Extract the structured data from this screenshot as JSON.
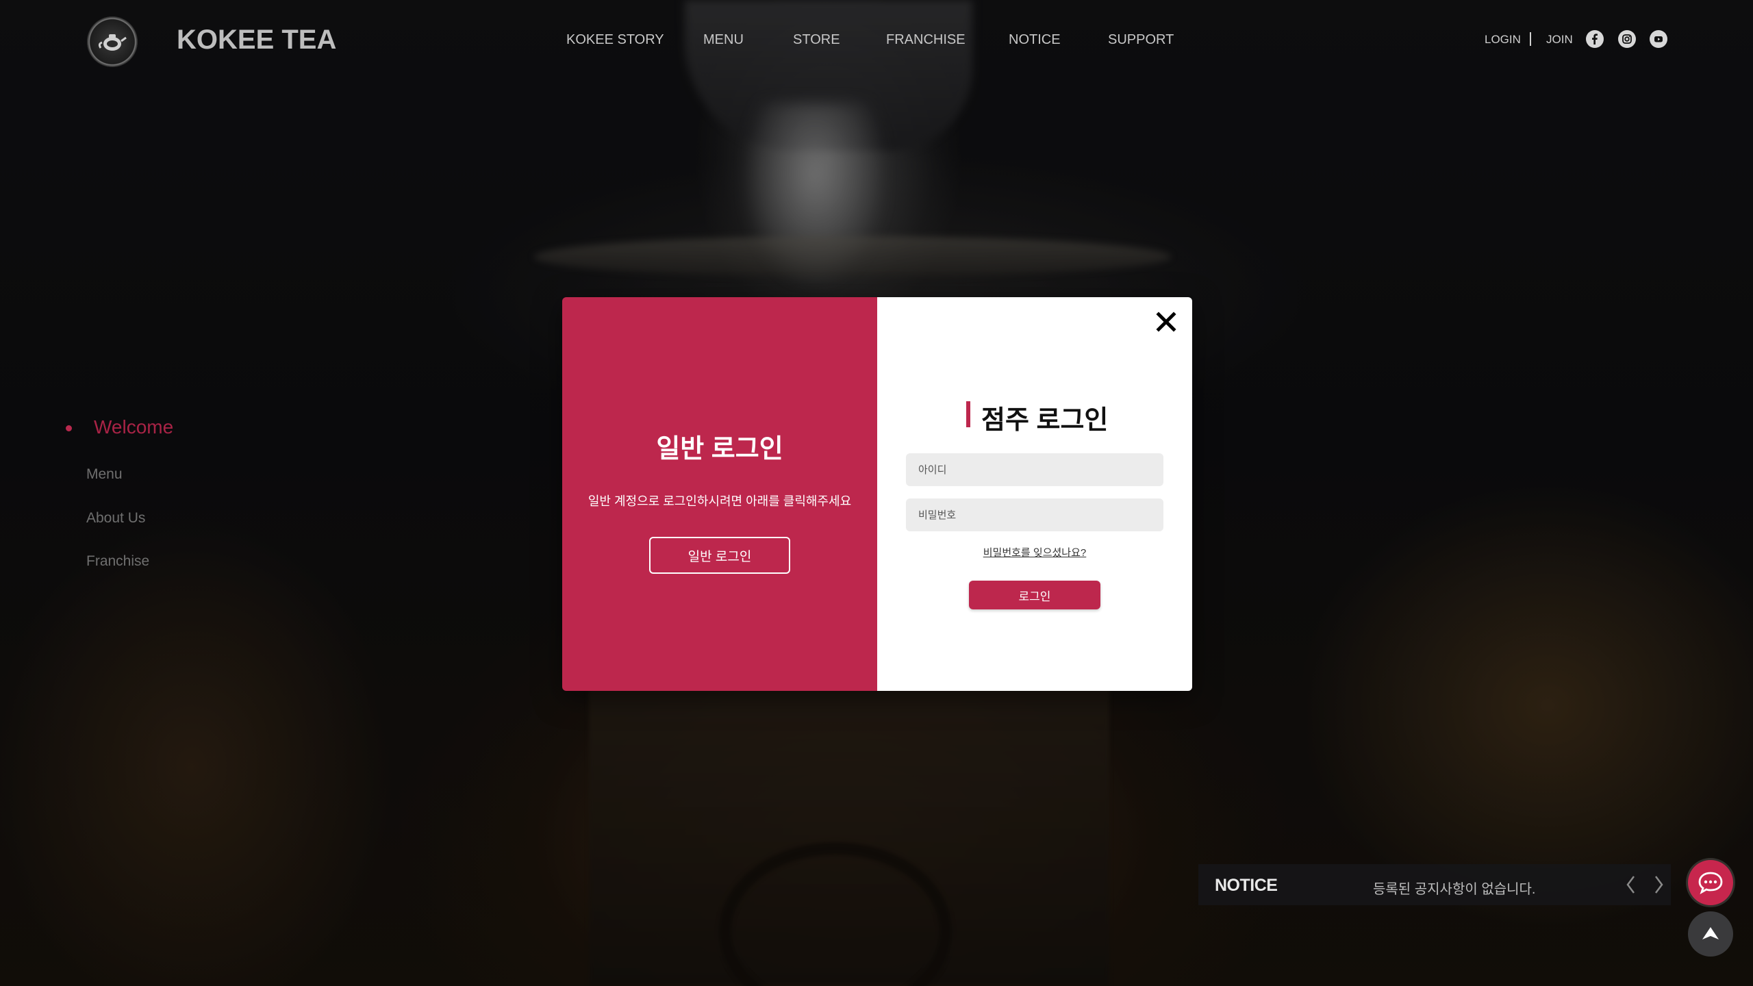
{
  "header": {
    "brand": "KOKEE TEA",
    "nav": [
      "KOKEE STORY",
      "MENU",
      "STORE",
      "FRANCHISE",
      "NOTICE",
      "SUPPORT"
    ],
    "login": "LOGIN",
    "join": "JOIN",
    "social_icons": [
      "facebook-icon",
      "instagram-icon",
      "youtube-icon"
    ]
  },
  "side_nav": {
    "active": "Welcome",
    "items": [
      "Menu",
      "About Us",
      "Franchise"
    ]
  },
  "modal": {
    "general": {
      "title": "일반 로그인",
      "description": "일반 계정으로 로그인하시려면 아래를 클릭해주세요",
      "button": "일반 로그인"
    },
    "owner": {
      "title": "점주 로그인",
      "id_placeholder": "아이디",
      "password_placeholder": "비밀번호",
      "forgot": "비밀번호를 잊으셨나요?",
      "login_button": "로그인"
    }
  },
  "notice": {
    "title": "NOTICE",
    "text": "등록된 공지사항이 없습니다."
  },
  "colors": {
    "accent": "#bd274d",
    "notice_bg": "#161618"
  }
}
